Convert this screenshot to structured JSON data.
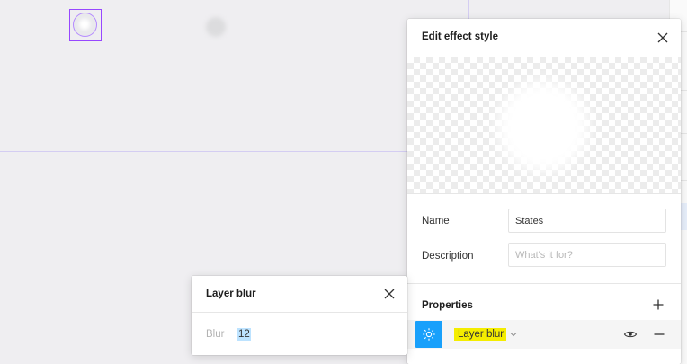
{
  "edit_effect_panel": {
    "title": "Edit effect style",
    "name_label": "Name",
    "name_value": "States",
    "description_label": "Description",
    "description_placeholder": "What's it for?",
    "properties_label": "Properties",
    "effect": {
      "type": "Layer blur",
      "type_icon": "sun-icon",
      "visible_icon": "eye-icon"
    }
  },
  "layer_blur_panel": {
    "title": "Layer blur",
    "blur_label": "Blur",
    "blur_value": "12"
  },
  "colors": {
    "selection": "#9747ff",
    "accent": "#18a0fb",
    "highlight": "#f4ed00",
    "text_selection": "#bde3ff"
  }
}
